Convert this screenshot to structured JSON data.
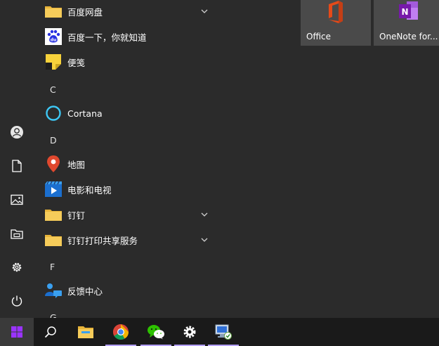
{
  "colors": {
    "background": "#2b2b2b",
    "tile": "#4a4a4a",
    "taskbar": "#1a1a1a",
    "running_indicator": "#b4a0ff",
    "start_button_accent": "#9a33ff"
  },
  "app_list": {
    "items": [
      {
        "kind": "app",
        "label": "百度网盘",
        "icon": "folder-icon",
        "expandable": true
      },
      {
        "kind": "app",
        "label": "百度一下，你就知道",
        "icon": "baidu-icon",
        "expandable": false
      },
      {
        "kind": "app",
        "label": "便笺",
        "icon": "sticky-notes-icon",
        "expandable": false
      },
      {
        "kind": "letter",
        "label": "C"
      },
      {
        "kind": "app",
        "label": "Cortana",
        "icon": "cortana-icon",
        "expandable": false
      },
      {
        "kind": "letter",
        "label": "D"
      },
      {
        "kind": "app",
        "label": "地图",
        "icon": "maps-icon",
        "expandable": false
      },
      {
        "kind": "app",
        "label": "电影和电视",
        "icon": "movies-tv-icon",
        "expandable": false
      },
      {
        "kind": "app",
        "label": "钉钉",
        "icon": "folder-icon",
        "expandable": true
      },
      {
        "kind": "app",
        "label": "钉钉打印共享服务",
        "icon": "folder-icon",
        "expandable": true
      },
      {
        "kind": "letter",
        "label": "F"
      },
      {
        "kind": "app",
        "label": "反馈中心",
        "icon": "feedback-hub-icon",
        "expandable": false
      },
      {
        "kind": "letter",
        "label": "G"
      }
    ]
  },
  "left_rail": {
    "items": [
      {
        "name": "user-account",
        "icon": "user-icon"
      },
      {
        "name": "documents",
        "icon": "document-icon"
      },
      {
        "name": "pictures",
        "icon": "pictures-icon"
      },
      {
        "name": "file-explorer",
        "icon": "file-explorer-icon"
      },
      {
        "name": "settings",
        "icon": "gear-icon"
      },
      {
        "name": "power",
        "icon": "power-icon"
      }
    ]
  },
  "tiles": [
    {
      "label": "Office",
      "icon": "office-icon"
    },
    {
      "label": "OneNote for...",
      "icon": "onenote-icon"
    }
  ],
  "taskbar": {
    "start": {
      "icon": "windows-logo-icon"
    },
    "items": [
      {
        "name": "search",
        "icon": "search-icon",
        "running": false
      },
      {
        "name": "file-explorer",
        "icon": "file-explorer-icon",
        "running": false
      },
      {
        "name": "chrome",
        "icon": "chrome-icon",
        "running": true
      },
      {
        "name": "wechat",
        "icon": "wechat-icon",
        "running": true
      },
      {
        "name": "settings",
        "icon": "gear-icon",
        "running": true
      },
      {
        "name": "remote-desktop",
        "icon": "remote-desktop-icon",
        "running": true
      }
    ]
  }
}
